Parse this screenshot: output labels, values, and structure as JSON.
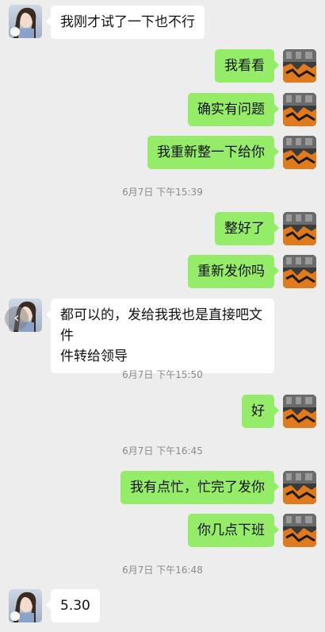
{
  "messages": [
    {
      "id": "m1",
      "side": "in",
      "text": "我刚才试了一下也不行"
    },
    {
      "id": "m2",
      "side": "out",
      "text": "我看看"
    },
    {
      "id": "m3",
      "side": "out",
      "text": "确实有问题"
    },
    {
      "id": "m4",
      "side": "out",
      "text": "我重新整一下给你"
    },
    {
      "id": "t1",
      "type": "time",
      "text": "6月7日 下午15:39"
    },
    {
      "id": "m5",
      "side": "out",
      "text": "整好了"
    },
    {
      "id": "m6",
      "side": "out",
      "text": "重新发你吗"
    },
    {
      "id": "m7",
      "side": "in",
      "text": "都可以的，发给我我也是直接吧文件转给领导"
    },
    {
      "id": "t2",
      "type": "time",
      "text": "6月7日 下午15:50"
    },
    {
      "id": "m8",
      "side": "out",
      "text": "好"
    },
    {
      "id": "t3",
      "type": "time",
      "text": "6月7日 下午16:45"
    },
    {
      "id": "m9",
      "side": "out",
      "text": "我有点忙，忙完了发你"
    },
    {
      "id": "m10",
      "side": "out",
      "text": "你几点下班"
    },
    {
      "id": "t4",
      "type": "time",
      "text": "6月7日 下午16:48"
    },
    {
      "id": "m11",
      "side": "in",
      "text": "5.30"
    }
  ],
  "m7_lines": [
    "都可以的，发给我我也是直接吧文件",
    "件转给领导"
  ],
  "colors": {
    "background": "#ededed",
    "outgoing_bubble": "#95ec69",
    "incoming_bubble": "#ffffff",
    "timestamp": "#8a8a8a"
  },
  "icons": {
    "back": "chevron-left-icon"
  }
}
